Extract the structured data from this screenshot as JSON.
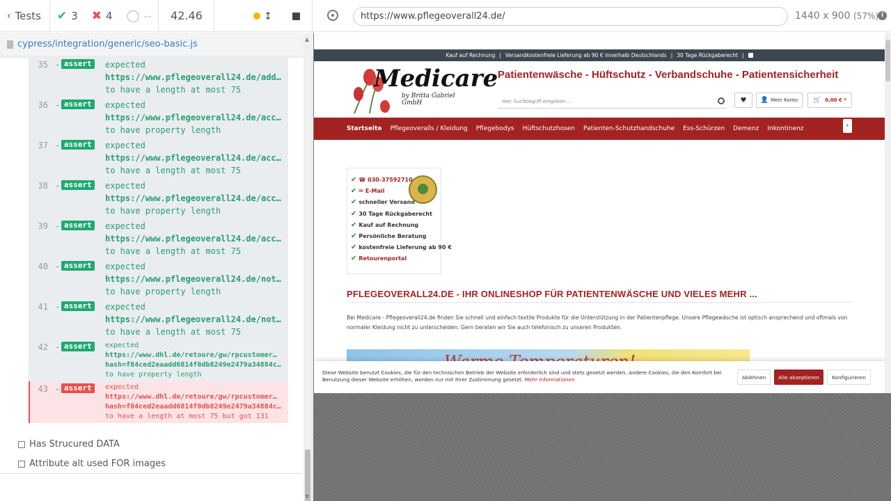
{
  "reporter": {
    "tests_label": "Tests",
    "passed": "3",
    "failed": "4",
    "pending": "--",
    "duration": "42.46",
    "spec_path": "cypress/integration/generic/seo-basic.js",
    "commands": [
      {
        "num": "35",
        "type": "assert",
        "lines": [
          "expected",
          "https://www.pflegeoverall24.de/add…",
          "to have a length at most 75"
        ]
      },
      {
        "num": "36",
        "type": "assert",
        "lines": [
          "expected",
          "https://www.pflegeoverall24.de/acc…",
          "to have property length"
        ]
      },
      {
        "num": "37",
        "type": "assert",
        "lines": [
          "expected",
          "https://www.pflegeoverall24.de/acc…",
          "to have a length at most 75"
        ]
      },
      {
        "num": "38",
        "type": "assert",
        "lines": [
          "expected",
          "https://www.pflegeoverall24.de/acc…",
          "to have property length"
        ]
      },
      {
        "num": "39",
        "type": "assert",
        "lines": [
          "expected",
          "https://www.pflegeoverall24.de/acc…",
          "to have a length at most 75"
        ]
      },
      {
        "num": "40",
        "type": "assert",
        "lines": [
          "expected",
          "https://www.pflegeoverall24.de/not…",
          "to have property length"
        ]
      },
      {
        "num": "41",
        "type": "assert",
        "lines": [
          "expected",
          "https://www.pflegeoverall24.de/not…",
          "to have a length at most 75"
        ]
      },
      {
        "num": "42",
        "type": "assert",
        "lines": [
          "expected",
          "https://www.dhl.de/retoure/gw/rpcustomer…",
          "hash=f84ced2eaadd6814f0db8249e2479a34884c…",
          "to have property length"
        ]
      },
      {
        "num": "43",
        "type": "assert",
        "failed": true,
        "lines": [
          "expected",
          "https://www.dhl.de/retoure/gw/rpcustomer…",
          "hash=f84ced2eaadd6814f0db8249e2479a34884c…",
          "to have a length at most 75 but got 131"
        ]
      }
    ],
    "suites": [
      "Has Strucured DATA",
      "Attribute alt used FOR images"
    ]
  },
  "aut": {
    "url": "https://www.pflegeoverall24.de/",
    "viewport": "1440 x 900",
    "scale": "(57%)"
  },
  "site": {
    "topbar": [
      "Kauf auf Rechnung",
      "|",
      "Versandkostenfreie Lieferung ab 90 € innerhalb Deutschlands",
      "|",
      "30 Tage Rückgaberecht",
      "|"
    ],
    "logo_title": "Medicare",
    "logo_sub": "by Britta Gabriel GmbH",
    "tagline": "Patientenwäsche - Hüftschutz - Verbandschuhe - Patientensicherheit",
    "search_placeholder": "Hier Suchbegriff eingeben ...",
    "account_label": "Mein Konto",
    "cart_label": "0,00 € *",
    "nav": [
      "Startseite",
      "Pflegeoveralls / Kleidung",
      "Pflegebodys",
      "Hüftschutzhosen",
      "Patienten-Schutzhandschuhe",
      "Ess-Schürzen",
      "Demenz",
      "Inkontinenz"
    ],
    "usp": [
      "☎ 030-37592710",
      "✉ E-Mail",
      "schneller Versand",
      "30 Tage Rückgaberecht",
      "Kauf auf Rechnung",
      "Persönliche Beratung",
      "kostenfreie Lieferung ab 90 €",
      "Retourenportal"
    ],
    "headline": "PFLEGEOVERALL24.DE - IHR ONLINESHOP FÜR PATIENTENWÄSCHE UND VIELES MEHR ...",
    "intro": "Bei Medicare - Pflegeoverall24.de finden Sie schnell und einfach textile Produkte für die Unterstützung in der Patientenpflege. Unsere Pflegewäsche ist optisch ansprechend und oftmals von normaler Kleidung nicht zu unterscheiden. Gern beraten wir Sie auch telefonisch zu unseren Produkten.",
    "banner_text": "Warme Temperaturen!",
    "cookie_text": "Diese Website benutzt Cookies, die für den technischen Betrieb der Website erforderlich sind und stets gesetzt werden. Andere Cookies, die den Komfort bei Benutzung dieser Website erhöhen, werden nur mit Ihrer Zustimmung gesetzt.",
    "cookie_more": "Mehr Informationen",
    "cookie_decline": "Ablehnen",
    "cookie_accept": "Alle akzeptieren",
    "cookie_config": "Konfigurieren"
  }
}
